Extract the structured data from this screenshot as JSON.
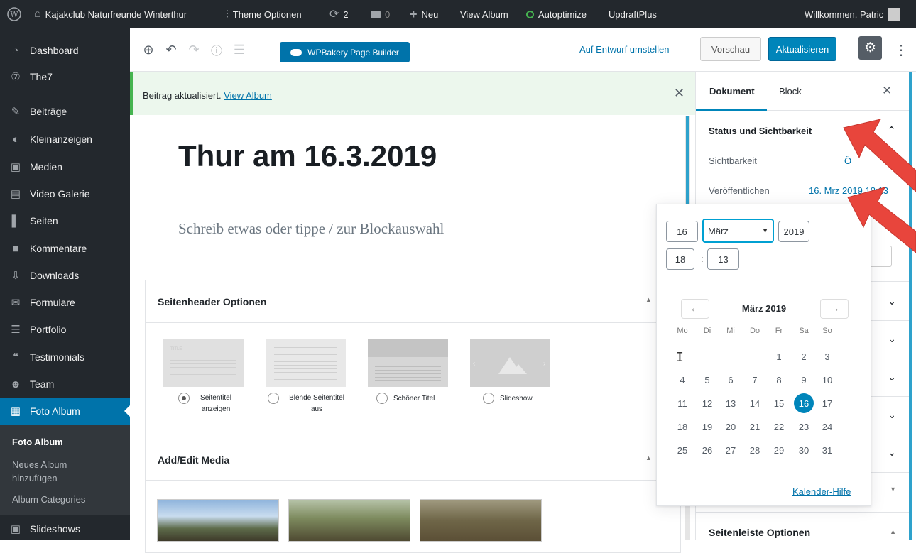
{
  "adminbar": {
    "site_name": "Kajakclub Naturfreunde Winterthur",
    "theme_options": "Theme Optionen",
    "updates_count": "2",
    "comments_count": "0",
    "new_label": "Neu",
    "view_album": "View Album",
    "autoptimize": "Autoptimize",
    "updraft": "UpdraftPlus",
    "welcome": "Willkommen, Patric"
  },
  "sidebar": {
    "items": [
      {
        "label": "Dashboard",
        "icon": "dashboard-icon"
      },
      {
        "label": "The7",
        "icon": "the7-icon"
      },
      {
        "label": "Beiträge",
        "icon": "pin-icon"
      },
      {
        "label": "Kleinanzeigen",
        "icon": "megaphone-icon"
      },
      {
        "label": "Medien",
        "icon": "media-icon"
      },
      {
        "label": "Video Galerie",
        "icon": "video-icon"
      },
      {
        "label": "Seiten",
        "icon": "page-icon"
      },
      {
        "label": "Kommentare",
        "icon": "comment-icon"
      },
      {
        "label": "Downloads",
        "icon": "download-icon"
      },
      {
        "label": "Formulare",
        "icon": "mail-icon"
      },
      {
        "label": "Portfolio",
        "icon": "portfolio-icon"
      },
      {
        "label": "Testimonials",
        "icon": "quote-icon"
      },
      {
        "label": "Team",
        "icon": "team-icon"
      },
      {
        "label": "Foto Album",
        "icon": "album-icon"
      }
    ],
    "submenu": {
      "current": "Foto Album",
      "add_new": "Neues Album hinzufügen",
      "categories": "Album Categories"
    },
    "slideshows": "Slideshows"
  },
  "toolbar": {
    "wpbakery": "WPBakery Page Builder",
    "draft": "Auf Entwurf umstellen",
    "preview": "Vorschau",
    "update": "Aktualisieren"
  },
  "notice": {
    "text": "Beitrag aktualisiert.",
    "link": "View Album"
  },
  "editor": {
    "title": "Thur am 16.3.2019",
    "placeholder": "Schreib etwas oder tippe / zur Blockauswahl",
    "header_options": {
      "title": "Seitenheader Optionen",
      "options": [
        {
          "label": "Seitentitel anzeigen",
          "selected": true
        },
        {
          "label": "Blende Seitentitel aus",
          "selected": false
        },
        {
          "label": "Schöner Titel",
          "selected": false
        },
        {
          "label": "Slideshow",
          "selected": false
        }
      ]
    },
    "media": {
      "title": "Add/Edit Media"
    }
  },
  "panel": {
    "tab_document": "Dokument",
    "tab_block": "Block",
    "status_title": "Status und Sichtbarkeit",
    "visibility_label": "Sichtbarkeit",
    "visibility_value": "Ö",
    "publish_label": "Veröffentlichen",
    "publish_value": "16. Mrz 2019 18:13",
    "sidebar_options": "Seitenleiste Optionen"
  },
  "datepicker": {
    "day": "16",
    "month": "März",
    "year": "2019",
    "hour": "18",
    "minute": "13",
    "month_title": "März 2019",
    "weekdays": [
      "Mo",
      "Di",
      "Mi",
      "Do",
      "Fr",
      "Sa",
      "So"
    ],
    "days": [
      "1",
      "2",
      "3",
      "4",
      "5",
      "6",
      "7",
      "8",
      "9",
      "10",
      "11",
      "12",
      "13",
      "14",
      "15",
      "16",
      "17",
      "18",
      "19",
      "20",
      "21",
      "22",
      "23",
      "24",
      "25",
      "26",
      "27",
      "28",
      "29",
      "30",
      "31"
    ],
    "selected_day": "16",
    "help": "Kalender-Hilfe"
  },
  "colors": {
    "accent": "#0085ba",
    "admin_bg": "#23282d",
    "notice_green": "#46b450",
    "arrow_red": "#e8453c"
  }
}
